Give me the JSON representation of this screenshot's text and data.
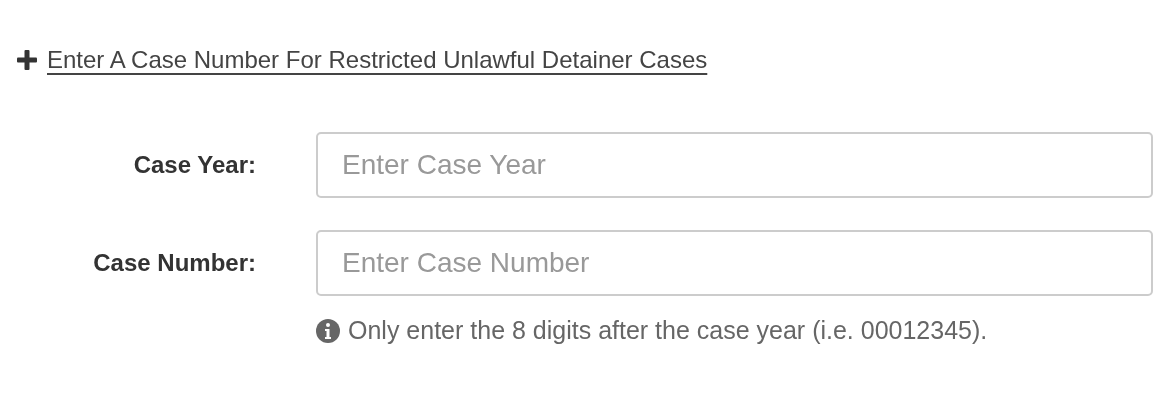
{
  "toggle_link": {
    "label": "Enter A Case Number For Restricted Unlawful Detainer Cases",
    "expanded": true
  },
  "fields": [
    {
      "label": "Case Year:",
      "placeholder": "Enter Case Year"
    },
    {
      "label": "Case Number:",
      "placeholder": "Enter Case Number",
      "help": "Only enter the 8 digits after the case year (i.e. 00012345)."
    }
  ]
}
